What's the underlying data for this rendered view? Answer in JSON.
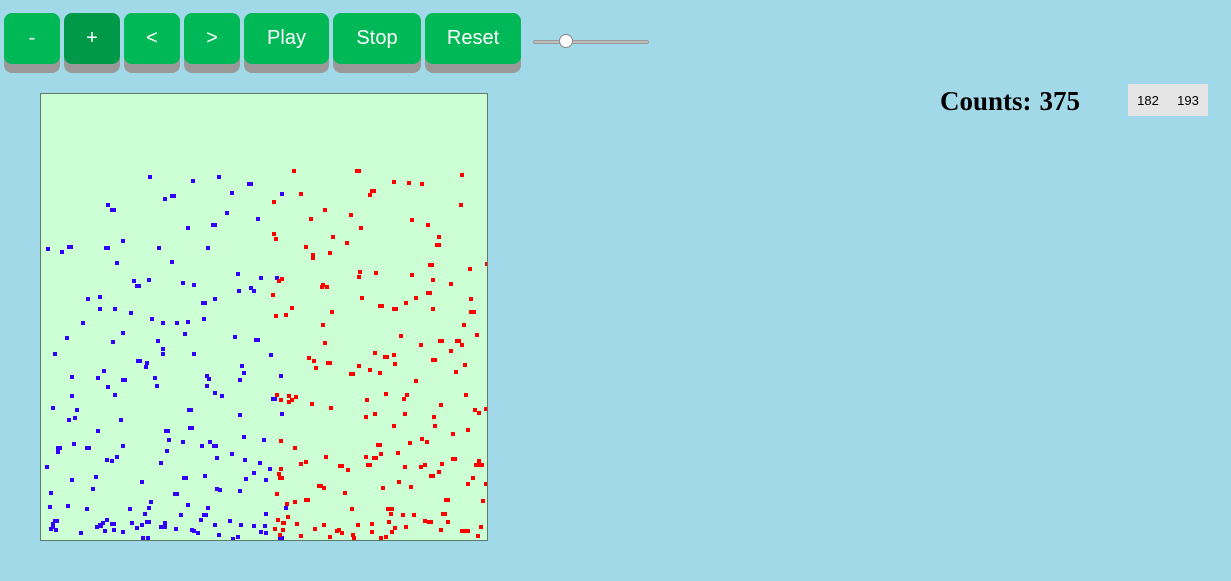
{
  "toolbar": {
    "minus_label": "-",
    "plus_label": "+",
    "prev_label": "<",
    "next_label": ">",
    "play_label": "Play",
    "stop_label": "Stop",
    "reset_label": "Reset",
    "speed_slider_fraction": 0.25
  },
  "counts": {
    "label": "Counts:",
    "total": "375",
    "blue": "182",
    "red": "193"
  },
  "colors": {
    "blue_particle": "#3300ff",
    "red_particle": "#ff0000",
    "field_background": "#ccffd3",
    "button": "#00b855",
    "button_active": "#00994a"
  }
}
